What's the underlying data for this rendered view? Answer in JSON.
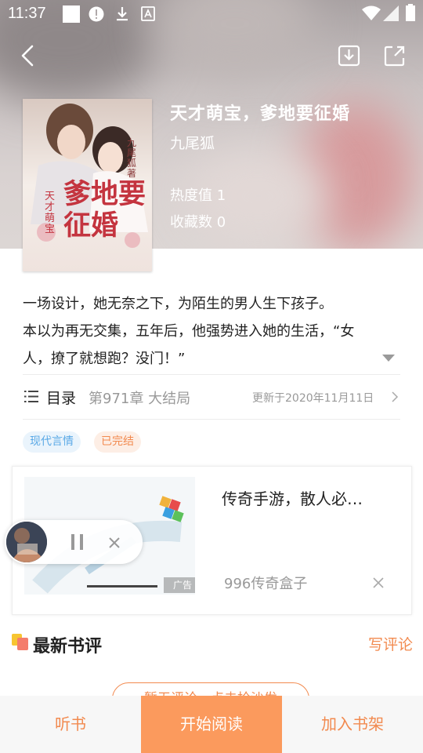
{
  "status_bar": {
    "time": "11:37"
  },
  "header": {
    "back_icon": "chevron-left-icon",
    "download_icon": "download-icon",
    "share_icon": "share-icon"
  },
  "book": {
    "title": "天才萌宝，爹地要征婚",
    "author": "九尾狐",
    "heat_label": "热度值 1",
    "favorites_label": "收藏数 0",
    "cover_text_main": "爹地要征婚",
    "cover_text_small": "天才萌宝",
    "cover_author": "九尾狐著"
  },
  "description": {
    "line1": "一场设计，她无奈之下，为陌生的男人生下孩子。",
    "line2": "本以为再无交集，五年后，他强势进入她的生活，“女",
    "line3": "人，撩了就想跑？没门！”"
  },
  "toc": {
    "label": "目录",
    "latest_chapter": "第971章 大结局",
    "updated": "更新于2020年11月11日"
  },
  "tags": [
    {
      "label": "现代言情",
      "color": "#5aa9e6",
      "bg": "#eaf4fc"
    },
    {
      "label": "已完结",
      "color": "#f28a4f",
      "bg": "#fdeee5"
    }
  ],
  "ad": {
    "title": "传奇手游，散人必…",
    "source": "996传奇盒子",
    "ad_tag": "广告"
  },
  "reviews": {
    "title": "最新书评",
    "write_label": "写评论",
    "empty_label": "暂无评论，点击抢沙发"
  },
  "bottom_bar": {
    "listen": "听书",
    "start_reading": "开始阅读",
    "add_to_shelf": "加入书架"
  },
  "colors": {
    "accent": "#f28a4f",
    "primary_button": "#fb9a5d"
  }
}
